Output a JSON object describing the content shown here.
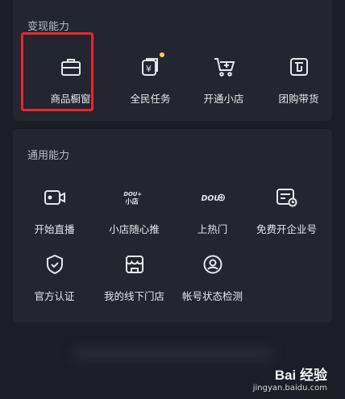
{
  "monetize": {
    "title": "变现能力",
    "items": [
      {
        "label": "商品橱窗",
        "icon": "briefcase-icon"
      },
      {
        "label": "全民任务",
        "icon": "yen-tasks-icon",
        "badge": true
      },
      {
        "label": "开通小店",
        "icon": "cart-plus-icon"
      },
      {
        "label": "团购带货",
        "icon": "group-buy-icon"
      }
    ]
  },
  "general": {
    "title": "通用能力",
    "items": [
      {
        "label": "开始直播",
        "icon": "video-camera-icon"
      },
      {
        "label": "小店随心推",
        "icon": "dou-plus-store-icon"
      },
      {
        "label": "上热门",
        "icon": "dou-plus-icon"
      },
      {
        "label": "免费开企业号",
        "icon": "enterprise-card-icon"
      },
      {
        "label": "官方认证",
        "icon": "shield-check-icon"
      },
      {
        "label": "我的线下门店",
        "icon": "store-icon"
      },
      {
        "label": "帐号状态检测",
        "icon": "account-check-icon"
      }
    ]
  },
  "watermark": {
    "main": "Bai 经验",
    "sub": "jingyan.baidu.com"
  },
  "colors": {
    "background": "#1b1d27",
    "card": "#232530",
    "highlight": "#e8262b",
    "badge": "#f7d44a"
  }
}
